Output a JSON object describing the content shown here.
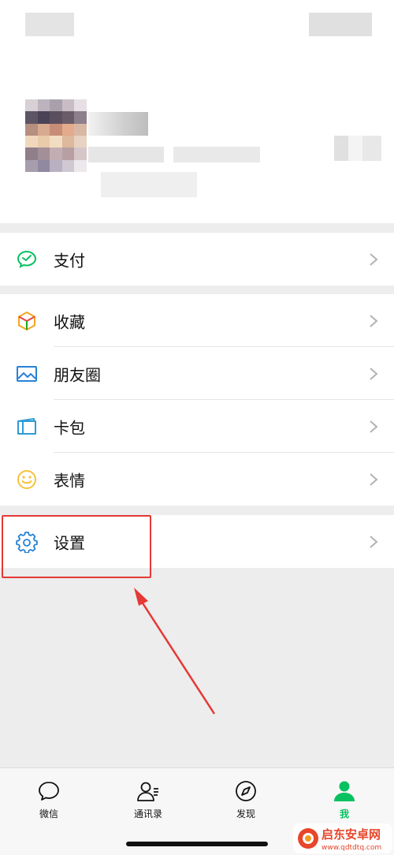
{
  "menu": {
    "pay": {
      "label": "支付",
      "icon": "wechat-pay-icon"
    },
    "favorites": {
      "label": "收藏",
      "icon": "cube-icon"
    },
    "moments": {
      "label": "朋友圈",
      "icon": "picture-icon"
    },
    "cards": {
      "label": "卡包",
      "icon": "card-icon"
    },
    "stickers": {
      "label": "表情",
      "icon": "smiley-icon"
    },
    "settings": {
      "label": "设置",
      "icon": "gear-icon"
    }
  },
  "tabbar": [
    {
      "label": "微信",
      "icon": "chat-bubble-icon",
      "active": false
    },
    {
      "label": "通讯录",
      "icon": "contacts-icon",
      "active": false
    },
    {
      "label": "发现",
      "icon": "compass-icon",
      "active": false
    },
    {
      "label": "我",
      "icon": "person-icon",
      "active": true
    }
  ],
  "watermark": {
    "title": "启东安卓网",
    "url": "www.qdtdtq.com"
  },
  "colors": {
    "accent": "#07c160",
    "annotation": "#e53935",
    "background": "#ededed"
  }
}
